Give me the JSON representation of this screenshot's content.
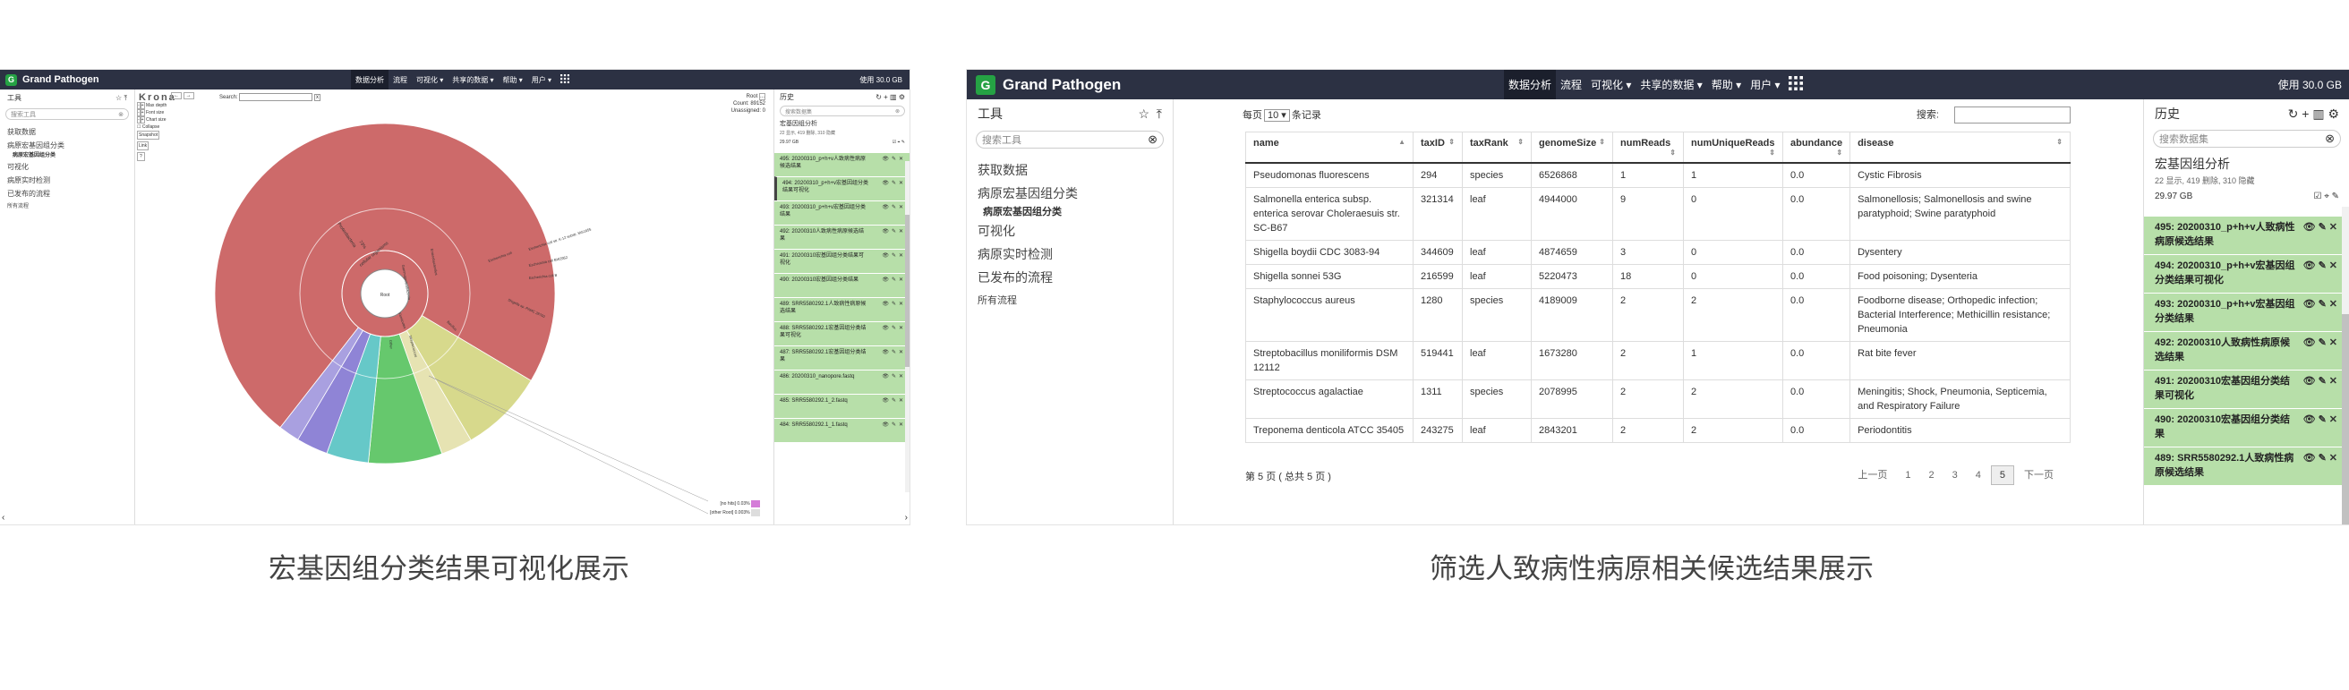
{
  "captions": {
    "left": "宏基因组分类结果可视化展示",
    "right": "筛选人致病性病原相关候选结果展示"
  },
  "colors": {
    "nav_bg": "#2c3143",
    "brand_green": "#25a244",
    "history_green": "#b7dfa9",
    "krona_red": "#cd6a6a"
  },
  "nav": {
    "brand": "Grand Pathogen",
    "logo": "G",
    "menu": [
      "数据分析",
      "流程",
      "可视化 ▾",
      "共享的数据 ▾",
      "帮助 ▾",
      "用户 ▾"
    ],
    "apps_icon": "grid-icon",
    "quota_left": "使用 30.0 GB",
    "quota_right": "使用 30.0 GB"
  },
  "tools": {
    "title": "工具",
    "search_placeholder": "搜索工具",
    "items": [
      "获取数据",
      "病原宏基因组分类",
      "病原宏基因组分类",
      "可视化",
      "病原实时检测",
      "已发布的流程",
      "所有流程"
    ]
  },
  "history": {
    "title": "历史",
    "search_placeholder": "搜索数据集",
    "name": "宏基因组分析",
    "stats": "22 显示, 419 删除, 310 隐藏",
    "size": "29.97 GB",
    "items_left": [
      "495: 20200310_p+h+v人致病性病原候选结果",
      "494: 20200310_p+h+v宏基因组分类结果可视化",
      "493: 20200310_p+h+v宏基因组分类结果",
      "492: 20200310人致病性病原候选结果",
      "491: 20200310宏基因组分类结果可视化",
      "490: 20200310宏基因组分类结果",
      "489: SRR5580292.1人致病性病原候选结果",
      "488: SRR5580292.1宏基因组分类结果可视化",
      "487: SRR5580292.1宏基因组分类结果",
      "486: 20200310_nanopore.fastq",
      "485: SRR5580292.1_2.fastq",
      "484: SRR5580292.1_1.fastq"
    ],
    "items_right": [
      "495: 20200310_p+h+v人致病性病原候选结果",
      "494: 20200310_p+h+v宏基因组分类结果可视化",
      "493: 20200310_p+h+v宏基因组分类结果",
      "492: 20200310人致病性病原候选结果",
      "491: 20200310宏基因组分类结果可视化",
      "490: 20200310宏基因组分类结果",
      "489: SRR5580292.1人致病性病原候选结果"
    ]
  },
  "krona": {
    "logo": "Krona",
    "search_label": "Search:",
    "controls": [
      "Max depth",
      "Font size",
      "Chart size"
    ],
    "collapse": "Collapse",
    "snapshot": "Snapshot",
    "link": "Link",
    "help": "?",
    "root_label": "Root",
    "count_label": "Count: 89152",
    "unassigned_label": "Unassigned:",
    "unassigned_value": "0",
    "center": "Root",
    "inner_labels": [
      "Bacteria",
      "cellular organisms"
    ],
    "segment_labels": [
      "Proteobacteria",
      "73%",
      "Gammaproteobacteria",
      "Firmicutes",
      "Enterobacterales",
      "Escherichia coli",
      "Escherichia coli str. K-12 substr. MG1655",
      "Escherichia coli BW2952",
      "Escherichia coli B",
      "Shigella sp. PAMC 28760",
      "Bacillus",
      "Streptococcus",
      "Other"
    ],
    "legend": [
      {
        "label": "[no hits]",
        "value": "0.03%"
      },
      {
        "label": "[other Root]",
        "value": "0.003%"
      }
    ]
  },
  "chart_data": {
    "type": "pie",
    "title": "",
    "rings": [
      "inner",
      "outer"
    ],
    "outer_slices": [
      {
        "label": "Proteobacteria",
        "value": 73,
        "color": "#cd6a6a"
      },
      {
        "label": "Enterobacterales",
        "value": 8,
        "color": "#d7d98c"
      },
      {
        "label": "Escherichia",
        "value": 3,
        "color": "#e6e3b2"
      },
      {
        "label": "Firmicutes",
        "value": 7,
        "color": "#66c86d"
      },
      {
        "label": "Bacillus",
        "value": 4,
        "color": "#66c8c8"
      },
      {
        "label": "Streptococcus",
        "value": 3,
        "color": "#8f84d6"
      },
      {
        "label": "Other",
        "value": 2,
        "color": "#a9a0e0"
      }
    ]
  },
  "table": {
    "length_prefix": "每页",
    "length_value": "10",
    "length_suffix": "条记录",
    "search_label": "搜索:",
    "columns": [
      "name",
      "taxID",
      "taxRank",
      "genomeSize",
      "numReads",
      "numUniqueReads",
      "abundance",
      "disease"
    ],
    "rows": [
      [
        "Pseudomonas fluorescens",
        "294",
        "species",
        "6526868",
        "1",
        "1",
        "0.0",
        "Cystic Fibrosis"
      ],
      [
        "Salmonella enterica subsp. enterica serovar Choleraesuis str. SC-B67",
        "321314",
        "leaf",
        "4944000",
        "9",
        "0",
        "0.0",
        "Salmonellosis; Salmonellosis and swine paratyphoid; Swine paratyphoid"
      ],
      [
        "Shigella boydii CDC 3083-94",
        "344609",
        "leaf",
        "4874659",
        "3",
        "0",
        "0.0",
        "Dysentery"
      ],
      [
        "Shigella sonnei 53G",
        "216599",
        "leaf",
        "5220473",
        "18",
        "0",
        "0.0",
        "Food poisoning; Dysenteria"
      ],
      [
        "Staphylococcus aureus",
        "1280",
        "species",
        "4189009",
        "2",
        "2",
        "0.0",
        "Foodborne disease; Orthopedic infection; Bacterial Interference; Methicillin resistance; Pneumonia"
      ],
      [
        "Streptobacillus moniliformis DSM 12112",
        "519441",
        "leaf",
        "1673280",
        "2",
        "1",
        "0.0",
        "Rat bite fever"
      ],
      [
        "Streptococcus agalactiae",
        "1311",
        "species",
        "2078995",
        "2",
        "2",
        "0.0",
        "Meningitis; Shock, Pneumonia, Septicemia, and Respiratory Failure"
      ],
      [
        "Treponema denticola ATCC 35405",
        "243275",
        "leaf",
        "2843201",
        "2",
        "2",
        "0.0",
        "Periodontitis"
      ]
    ],
    "info": "第 5 页 ( 总共 5 页 )",
    "pager": [
      "上一页",
      "1",
      "2",
      "3",
      "4",
      "5",
      "下一页"
    ],
    "current_page": "5"
  }
}
